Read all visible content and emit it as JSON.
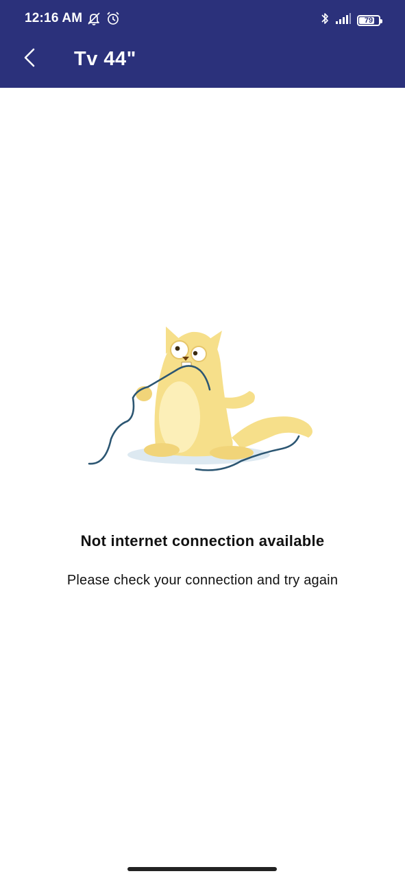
{
  "status_bar": {
    "time": "12:16 AM",
    "left_icons": [
      "muted-bell-icon",
      "alarm-icon"
    ],
    "right_icons": [
      "bluetooth-icon",
      "signal-icon",
      "battery-icon"
    ],
    "battery_level": "79",
    "battery_fraction": 0.79
  },
  "app_bar": {
    "title": "Tv 44\"",
    "back_icon": "back-arrow-icon",
    "background_color": "#2b317b"
  },
  "empty_state": {
    "illustration": "cat-chewing-cable-illustration",
    "title": "Not internet connection available",
    "message": "Please check your connection and try again"
  }
}
